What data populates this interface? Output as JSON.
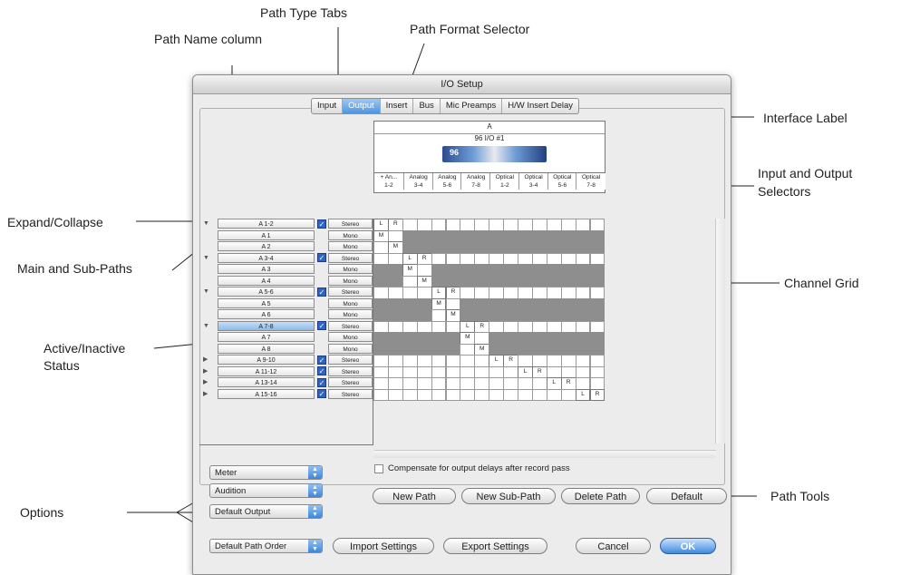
{
  "callouts": {
    "path_type_tabs": "Path Type Tabs",
    "path_name_column": "Path Name column",
    "path_format_selector": "Path Format Selector",
    "interface_label": "Interface Label",
    "input_output_selectors_1": "Input and Output",
    "input_output_selectors_2": "Selectors",
    "expand_collapse": "Expand/Collapse",
    "main_sub_paths": "Main and Sub-Paths",
    "channel_grid": "Channel Grid",
    "active_inactive_1": "Active/Inactive",
    "active_inactive_2": "Status",
    "options": "Options",
    "path_tools": "Path Tools"
  },
  "window": {
    "title": "I/O Setup"
  },
  "tabs": [
    "Input",
    "Output",
    "Insert",
    "Bus",
    "Mic Preamps",
    "H/W Insert Delay"
  ],
  "active_tab": "Output",
  "interface": {
    "label": "A",
    "device": "96 I/O #1",
    "badge": "96"
  },
  "selectors": [
    {
      "top": "+ An...",
      "bottom": "1-2"
    },
    {
      "top": "Analog",
      "bottom": "3-4"
    },
    {
      "top": "Analog",
      "bottom": "5-6"
    },
    {
      "top": "Analog",
      "bottom": "7-8"
    },
    {
      "top": "Optical",
      "bottom": "1-2"
    },
    {
      "top": "Optical",
      "bottom": "3-4"
    },
    {
      "top": "Optical",
      "bottom": "5-6"
    },
    {
      "top": "Optical",
      "bottom": "7-8"
    }
  ],
  "paths": [
    {
      "name": "A 1-2",
      "format": "Stereo",
      "main": true,
      "expanded": true,
      "selected": false
    },
    {
      "name": "A 1",
      "format": "Mono",
      "main": false
    },
    {
      "name": "A 2",
      "format": "Mono",
      "main": false
    },
    {
      "name": "A 3-4",
      "format": "Stereo",
      "main": true,
      "expanded": true,
      "selected": false
    },
    {
      "name": "A 3",
      "format": "Mono",
      "main": false
    },
    {
      "name": "A 4",
      "format": "Mono",
      "main": false
    },
    {
      "name": "A 5-6",
      "format": "Stereo",
      "main": true,
      "expanded": true,
      "selected": false
    },
    {
      "name": "A 5",
      "format": "Mono",
      "main": false
    },
    {
      "name": "A 6",
      "format": "Mono",
      "main": false
    },
    {
      "name": "A 7-8",
      "format": "Stereo",
      "main": true,
      "expanded": true,
      "selected": true
    },
    {
      "name": "A 7",
      "format": "Mono",
      "main": false
    },
    {
      "name": "A 8",
      "format": "Mono",
      "main": false
    },
    {
      "name": "A 9-10",
      "format": "Stereo",
      "main": true,
      "expanded": false,
      "selected": false
    },
    {
      "name": "A 11-12",
      "format": "Stereo",
      "main": true,
      "expanded": false,
      "selected": false
    },
    {
      "name": "A 13-14",
      "format": "Stereo",
      "main": true,
      "expanded": false,
      "selected": false
    },
    {
      "name": "A 15-16",
      "format": "Stereo",
      "main": true,
      "expanded": false,
      "selected": false
    }
  ],
  "grid_labels": {
    "left": "L",
    "right": "R",
    "mono": "M"
  },
  "options": {
    "compensate_label": "Compensate for output delays after record pass",
    "popups": [
      "Meter",
      "Audition",
      "Default Output"
    ],
    "path_order": "Default Path Order"
  },
  "path_tools": [
    "New Path",
    "New Sub-Path",
    "Delete Path",
    "Default"
  ],
  "bottom_buttons": {
    "import": "Import Settings",
    "export": "Export Settings",
    "cancel": "Cancel",
    "ok": "OK"
  },
  "colors": {
    "accent": "#4f95e0",
    "grid_inactive": "#8e8e8e",
    "selected_row": "#8bbbeb"
  }
}
